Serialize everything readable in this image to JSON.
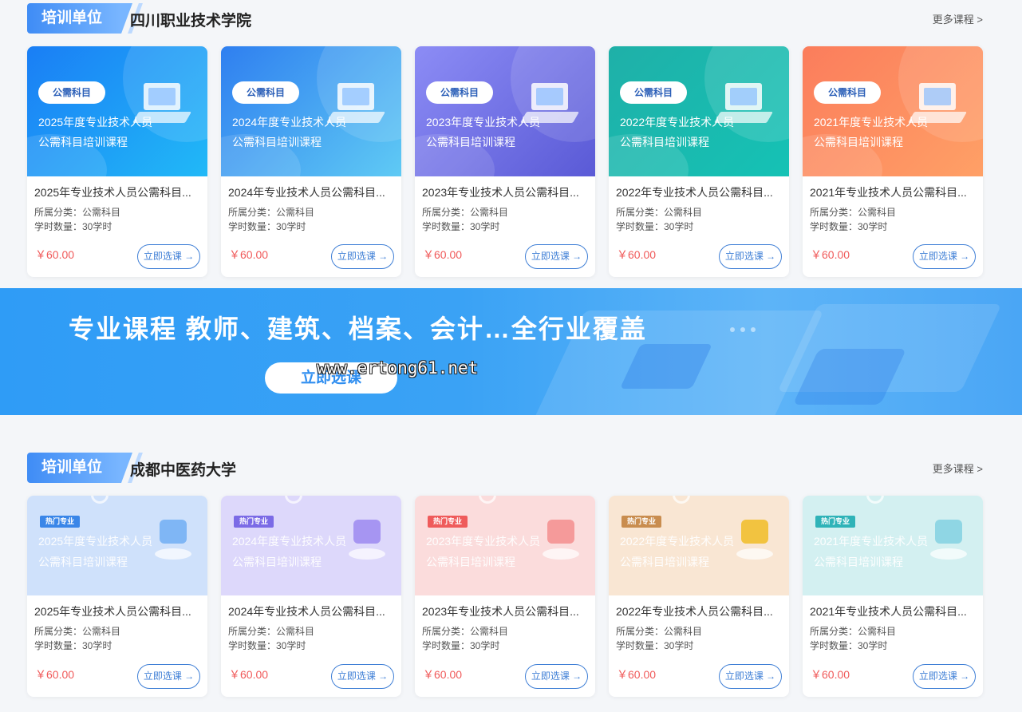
{
  "section1": {
    "tag": "培训单位",
    "org": "四川职业技术学院",
    "more": "更多课程 >",
    "cards": [
      {
        "badge": "公需科目",
        "line1": "2025年度专业技术人员",
        "line2": "公需科目培训课程",
        "title": "2025年专业技术人员公需科目...",
        "category": "所属分类：公需科目",
        "hours": "学时数量：30学时",
        "price": "￥60.00",
        "button": "立即选课 →",
        "color_a": "#1a7ef5",
        "color_b": "#21b9f7"
      },
      {
        "badge": "公需科目",
        "line1": "2024年度专业技术人员",
        "line2": "公需科目培训课程",
        "title": "2024年专业技术人员公需科目...",
        "category": "所属分类：公需科目",
        "hours": "学时数量：30学时",
        "price": "￥60.00",
        "button": "立即选课 →",
        "color_a": "#2f7ff0",
        "color_b": "#5fcaf4"
      },
      {
        "badge": "公需科目",
        "line1": "2023年度专业技术人员",
        "line2": "公需科目培训课程",
        "title": "2023年专业技术人员公需科目...",
        "category": "所属分类：公需科目",
        "hours": "学时数量：30学时",
        "price": "￥60.00",
        "button": "立即选课 →",
        "color_a": "#8c8cf5",
        "color_b": "#5a5ad6"
      },
      {
        "badge": "公需科目",
        "line1": "2022年度专业技术人员",
        "line2": "公需科目培训课程",
        "title": "2022年专业技术人员公需科目...",
        "category": "所属分类：公需科目",
        "hours": "学时数量：30学时",
        "price": "￥60.00",
        "button": "立即选课 →",
        "color_a": "#1fb0a8",
        "color_b": "#15c2b5"
      },
      {
        "badge": "公需科目",
        "line1": "2021年度专业技术人员",
        "line2": "公需科目培训课程",
        "title": "2021年专业技术人员公需科目...",
        "category": "所属分类：公需科目",
        "hours": "学时数量：30学时",
        "price": "￥60.00",
        "button": "立即选课 →",
        "color_a": "#fb7d5c",
        "color_b": "#ffa066"
      }
    ]
  },
  "banner": {
    "slogan": "专业课程  教师、建筑、档案、会计…全行业覆盖",
    "cta": "立即选课",
    "watermark": "www.ertong61.net"
  },
  "section2": {
    "tag": "培训单位",
    "org": "成都中医药大学",
    "more": "更多课程 >",
    "cards": [
      {
        "hot": "热门专业",
        "line1": "2025年度专业技术人员",
        "line2": "公需科目培训课程",
        "title": "2025年专业技术人员公需科目...",
        "category": "所属分类：公需科目",
        "hours": "学时数量：30学时",
        "price": "￥60.00",
        "button": "立即选课 →",
        "bg": "#cfe1fb",
        "hot_color": "#3a86e8",
        "accent": "#7fb6f5"
      },
      {
        "hot": "热门专业",
        "line1": "2024年度专业技术人员",
        "line2": "公需科目培训课程",
        "title": "2024年专业技术人员公需科目...",
        "category": "所属分类：公需科目",
        "hours": "学时数量：30学时",
        "price": "￥60.00",
        "button": "立即选课 →",
        "bg": "#ddd8fb",
        "hot_color": "#7b6be6",
        "accent": "#a695f2"
      },
      {
        "hot": "热门专业",
        "line1": "2023年度专业技术人员",
        "line2": "公需科目培训课程",
        "title": "2023年专业技术人员公需科目...",
        "category": "所属分类：公需科目",
        "hours": "学时数量：30学时",
        "price": "￥60.00",
        "button": "立即选课 →",
        "bg": "#fbdcdc",
        "hot_color": "#ef5b5b",
        "accent": "#f59a9a"
      },
      {
        "hot": "热门专业",
        "line1": "2022年度专业技术人员",
        "line2": "公需科目培训课程",
        "title": "2022年专业技术人员公需科目...",
        "category": "所属分类：公需科目",
        "hours": "学时数量：30学时",
        "price": "￥60.00",
        "button": "立即选课 →",
        "bg": "#f9e6d3",
        "hot_color": "#c98d4f",
        "accent": "#f2c340"
      },
      {
        "hot": "热门专业",
        "line1": "2021年度专业技术人员",
        "line2": "公需科目培训课程",
        "title": "2021年专业技术人员公需科目...",
        "category": "所属分类：公需科目",
        "hours": "学时数量：30学时",
        "price": "￥60.00",
        "button": "立即选课 →",
        "bg": "#d3f0f1",
        "hot_color": "#2fb3b8",
        "accent": "#8fd6e4"
      }
    ]
  }
}
